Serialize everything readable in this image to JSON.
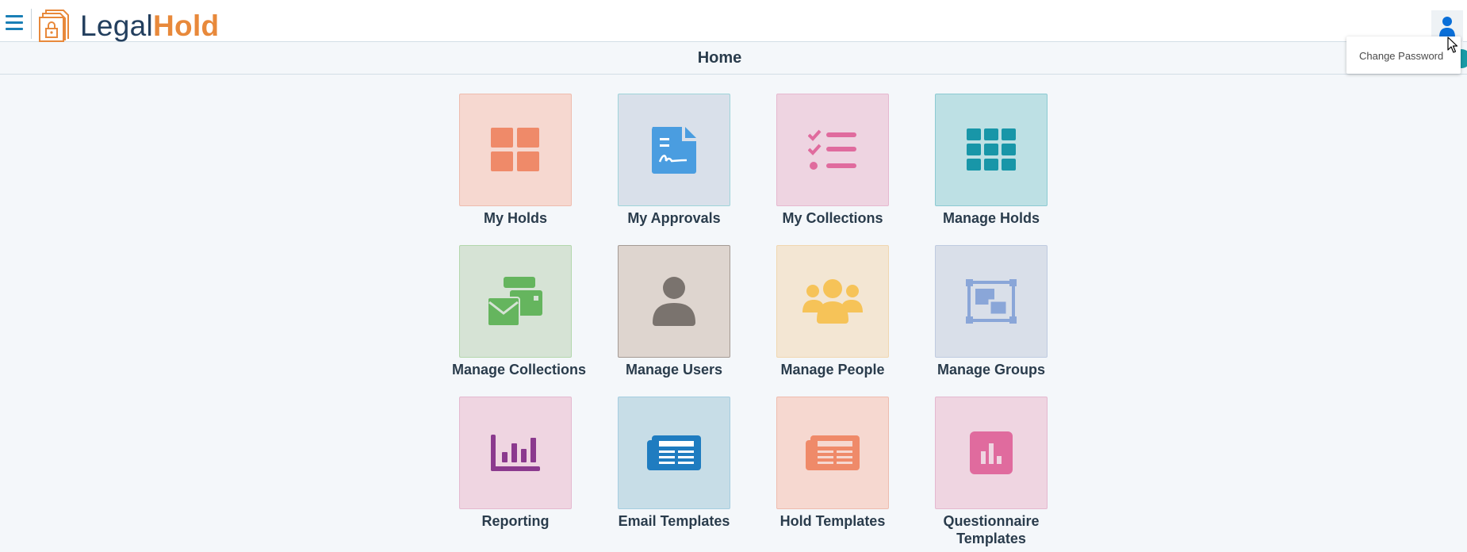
{
  "header": {
    "logo": {
      "part1": "Legal",
      "part2": "Hold"
    },
    "menu_icon": "hamburger-menu-icon",
    "user_icon": "user-icon"
  },
  "page": {
    "title": "Home"
  },
  "user_menu": {
    "items": [
      {
        "label": "Change Password"
      }
    ]
  },
  "tiles": [
    {
      "label": "My Holds",
      "icon": "grid-four-icon",
      "bg": "#f6d8d0",
      "border": "#eebcae",
      "fg": "#ef8a69"
    },
    {
      "label": "My Approvals",
      "icon": "document-signature-icon",
      "bg": "#d9e0ea",
      "border": "#9fd4da",
      "fg": "#4a9de0"
    },
    {
      "label": "My Collections",
      "icon": "checklist-icon",
      "bg": "#eed4e1",
      "border": "#e6b8cf",
      "fg": "#e06b9e"
    },
    {
      "label": "Manage Holds",
      "icon": "grid-nine-icon",
      "bg": "#bde0e4",
      "border": "#8ccad2",
      "fg": "#1896a8"
    },
    {
      "label": "Manage Collections",
      "icon": "envelopes-icon",
      "bg": "#d6e3d5",
      "border": "#b3d7ac",
      "fg": "#65b55e"
    },
    {
      "label": "Manage Users",
      "icon": "user-icon",
      "bg": "#ded5cf",
      "border": "#a49a94",
      "fg": "#7a736e"
    },
    {
      "label": "Manage People",
      "icon": "people-group-icon",
      "bg": "#f3e6d3",
      "border": "#f0d7b0",
      "fg": "#f6c358"
    },
    {
      "label": "Manage Groups",
      "icon": "object-group-icon",
      "bg": "#d9dfe9",
      "border": "#bfcbe0",
      "fg": "#8aa6d8"
    },
    {
      "label": "Reporting",
      "icon": "bar-chart-icon",
      "bg": "#efd5e1",
      "border": "#e4b8cf",
      "fg": "#8b3a8e"
    },
    {
      "label": "Email Templates",
      "icon": "newspaper-icon",
      "bg": "#c7dde7",
      "border": "#a5cde0",
      "fg": "#1f7cc0"
    },
    {
      "label": "Hold Templates",
      "icon": "newspaper-icon",
      "bg": "#f6d8d0",
      "border": "#eebcae",
      "fg": "#ef8a69"
    },
    {
      "label": "Questionnaire Templates",
      "icon": "square-chart-icon",
      "bg": "#efd5e1",
      "border": "#e4b8cf",
      "fg": "#e06b9e"
    }
  ]
}
